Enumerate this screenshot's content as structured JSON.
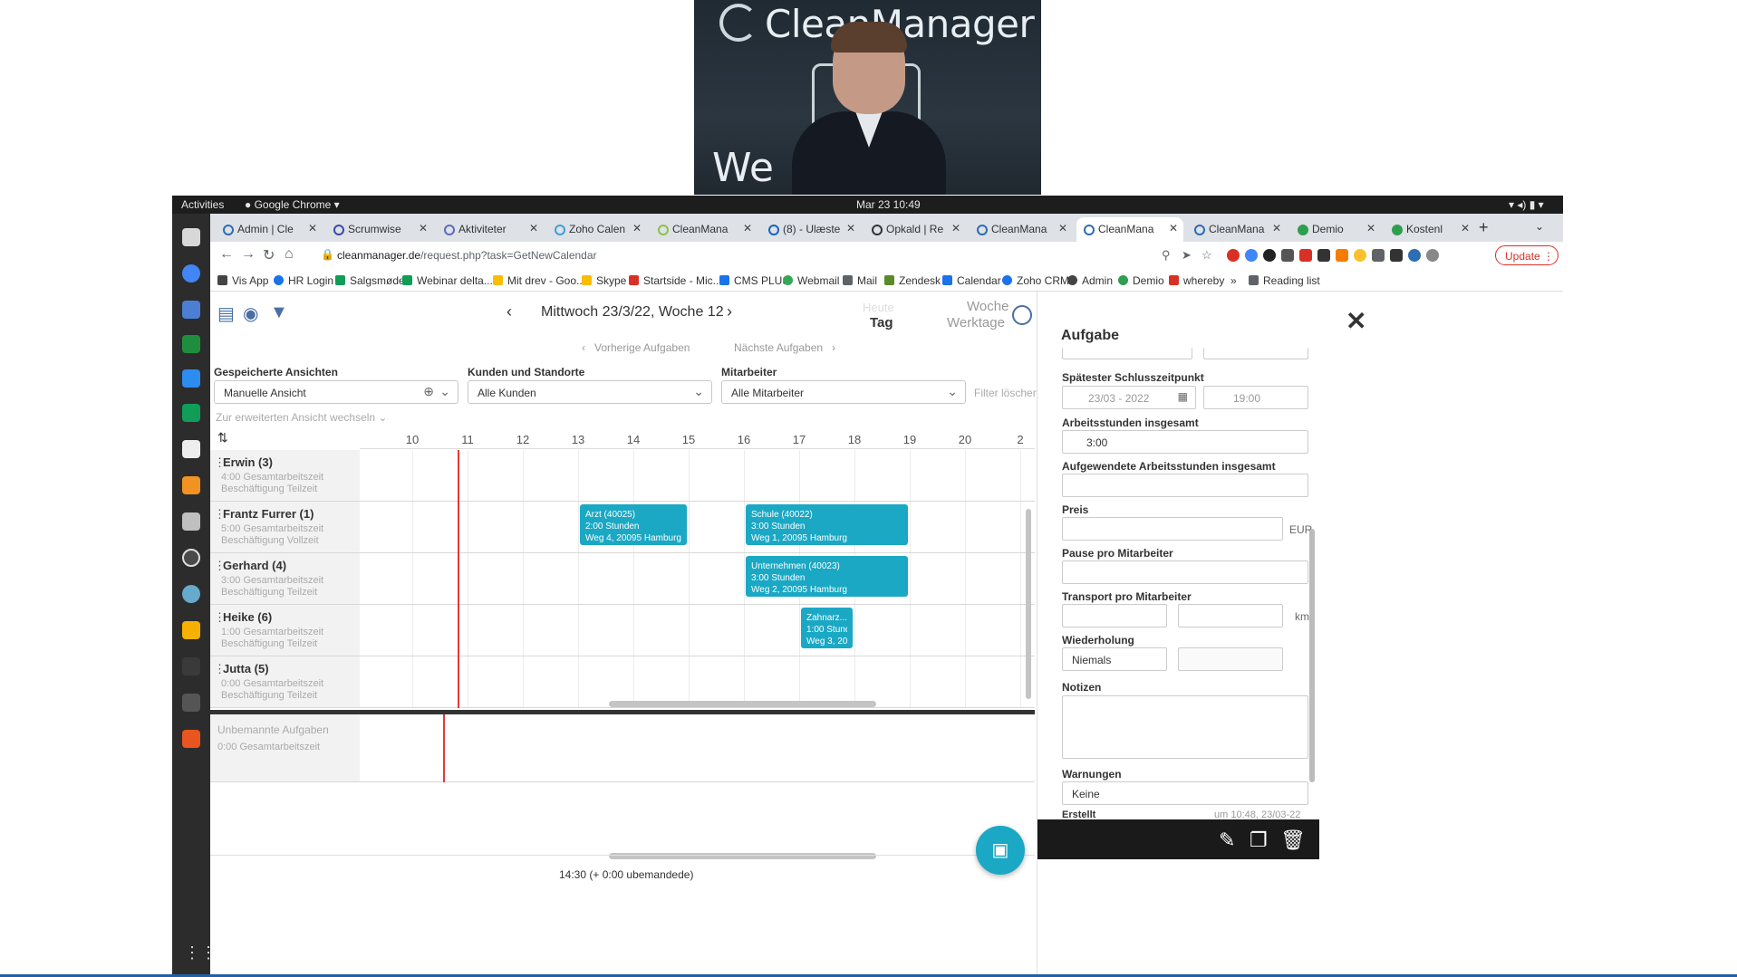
{
  "webcam": {
    "brand_text": "CleanManager",
    "sign_text": "We"
  },
  "os": {
    "activities": "Activities",
    "app_name": "Google Chrome",
    "clock": "Mar 23  10:49"
  },
  "tabs": [
    {
      "label": "Admin | Cle"
    },
    {
      "label": "Scrumwise"
    },
    {
      "label": "Aktiviteter"
    },
    {
      "label": "Zoho Calen"
    },
    {
      "label": "CleanMana"
    },
    {
      "label": "(8) - Ulæste"
    },
    {
      "label": "Opkald | Re"
    },
    {
      "label": "CleanMana"
    },
    {
      "label": "CleanMana"
    },
    {
      "label": "CleanMana"
    },
    {
      "label": "Demio"
    },
    {
      "label": "Kostenl"
    }
  ],
  "browser": {
    "url_domain": "cleanmanager.de",
    "url_path": "/request.php?task=GetNewCalendar",
    "update_label": "Update"
  },
  "bookmarks": [
    {
      "label": "Vis App",
      "color": "#444444"
    },
    {
      "label": "HR Login",
      "color": "#1a73e8"
    },
    {
      "label": "Salgsmøde",
      "color": "#0f9d58"
    },
    {
      "label": "Webinar delta...",
      "color": "#0f9d58"
    },
    {
      "label": "Mit drev - Goo...",
      "color": "#fbbc04"
    },
    {
      "label": "Skype",
      "color": "#fbbc04"
    },
    {
      "label": "Startside - Mic...",
      "color": "#d93025"
    },
    {
      "label": "CMS PLUS",
      "color": "#1a73e8"
    },
    {
      "label": "Webmail",
      "color": "#34a853"
    },
    {
      "label": "Mail",
      "color": "#5f6368"
    },
    {
      "label": "Zendesk",
      "color": "#5b8a2a"
    },
    {
      "label": "Calendar",
      "color": "#1a73e8"
    },
    {
      "label": "Zoho CRM",
      "color": "#1a73e8"
    },
    {
      "label": "Admin",
      "color": "#444444"
    },
    {
      "label": "Demio",
      "color": "#2e9e4f"
    },
    {
      "label": "whereby",
      "color": "#d93025"
    },
    {
      "label": "»",
      "color": "#ffffff"
    },
    {
      "label": "Reading list",
      "color": "#5f6368"
    }
  ],
  "calendar": {
    "date_title": "Mittwoch 23/3/22, Woche 12",
    "view_today": "Heute",
    "view_day": "Tag",
    "view_week": "Woche",
    "view_workdays": "Werktage",
    "prev_tasks": "Vorherige Aufgaben",
    "next_tasks": "Nächste Aufgaben",
    "saved_views_label": "Gespeicherte Ansichten",
    "saved_views_value": "Manuelle Ansicht",
    "customers_label": "Kunden und Standorte",
    "customers_value": "Alle Kunden",
    "employees_label": "Mitarbeiter",
    "employees_value": "Alle Mitarbeiter",
    "filter_clear": "Filter löschen",
    "extended_view": "Zur erweiterten Ansicht wechseln",
    "hours": [
      "10",
      "11",
      "12",
      "13",
      "14",
      "15",
      "16",
      "17",
      "18",
      "19",
      "20",
      "2"
    ],
    "employees": [
      {
        "name": "Erwin  (3)",
        "hours": "4:00 Gesamtarbeitszeit",
        "type": "Beschäftigung Teilzeit"
      },
      {
        "name": "Frantz Furrer  (1)",
        "hours": "5:00 Gesamtarbeitszeit",
        "type": "Beschäftigung Vollzeit"
      },
      {
        "name": "Gerhard  (4)",
        "hours": "3:00 Gesamtarbeitszeit",
        "type": "Beschäftigung Teilzeit"
      },
      {
        "name": "Heike  (6)",
        "hours": "1:00 Gesamtarbeitszeit",
        "type": "Beschäftigung Teilzeit"
      },
      {
        "name": "Jutta  (5)",
        "hours": "0:00 Gesamtarbeitszeit",
        "type": "Beschäftigung Teilzeit"
      }
    ],
    "tasks": [
      {
        "title": "Arzt (40025)",
        "duration": "2:00 Stunden",
        "address": "Weg 4, 20095 Hamburg"
      },
      {
        "title": "Schule (40022)",
        "duration": "3:00 Stunden",
        "address": "Weg 1, 20095 Hamburg"
      },
      {
        "title": "Unternehmen (40023)",
        "duration": "3:00 Stunden",
        "address": "Weg 2, 20095 Hamburg"
      },
      {
        "title": "Zahnarz...",
        "duration": "1:00 Stund...",
        "address": "Weg 3, 20..."
      }
    ],
    "unassigned_title": "Unbemannte Aufgaben",
    "unassigned_hours": "0:00 Gesamtarbeitszeit",
    "footer_text": "14:30 (+ 0:00 ubemandede)",
    "accent_color": "#1aa8c4",
    "now_line_color": "#e53935"
  },
  "panel": {
    "title": "Aufgabe",
    "latest_end_label": "Spätester Schlusszeitpunkt",
    "latest_end_date": "23/03 - 2022",
    "latest_end_time": "19:00",
    "work_hours_label": "Arbeitsstunden insgesamt",
    "work_hours_value": "3:00",
    "spent_hours_label": "Aufgewendete Arbeitsstunden insgesamt",
    "price_label": "Preis",
    "price_unit": "EUR",
    "pause_label": "Pause pro Mitarbeiter",
    "transport_label": "Transport pro Mitarbeiter",
    "transport_unit": "km",
    "repeat_label": "Wiederholung",
    "repeat_value": "Niemals",
    "notes_label": "Notizen",
    "warnings_label": "Warnungen",
    "warnings_value": "Keine",
    "created_label": "Erstellt",
    "created_value": "um 10:48, 23/03-22"
  }
}
